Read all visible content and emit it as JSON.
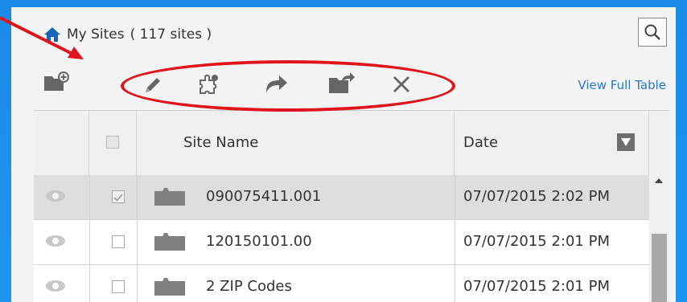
{
  "breadcrumb": {
    "title": "My Sites",
    "count": "( 117 sites )"
  },
  "toolbar": {
    "add_folder_icon": "folder-add-icon",
    "edit_icon": "pencil-icon",
    "settings_icon": "puzzle-gear-icon",
    "share_icon": "share-arrow-icon",
    "move_icon": "folder-move-icon",
    "delete_icon": "close-icon",
    "view_full_table": "View Full Table"
  },
  "table": {
    "headers": {
      "site_name": "Site Name",
      "date": "Date"
    },
    "rows": [
      {
        "name": "090075411.001",
        "date": "07/07/2015 2:02 PM",
        "checked": true,
        "selected": true
      },
      {
        "name": "120150101.00",
        "date": "07/07/2015 2:01 PM",
        "checked": false,
        "selected": false
      },
      {
        "name": "2 ZIP Codes",
        "date": "07/07/2015 2:01 PM",
        "checked": false,
        "selected": false
      }
    ]
  },
  "colors": {
    "accent": "#2a78c8",
    "annotation": "#e0151c",
    "background": "#1f95ef"
  }
}
